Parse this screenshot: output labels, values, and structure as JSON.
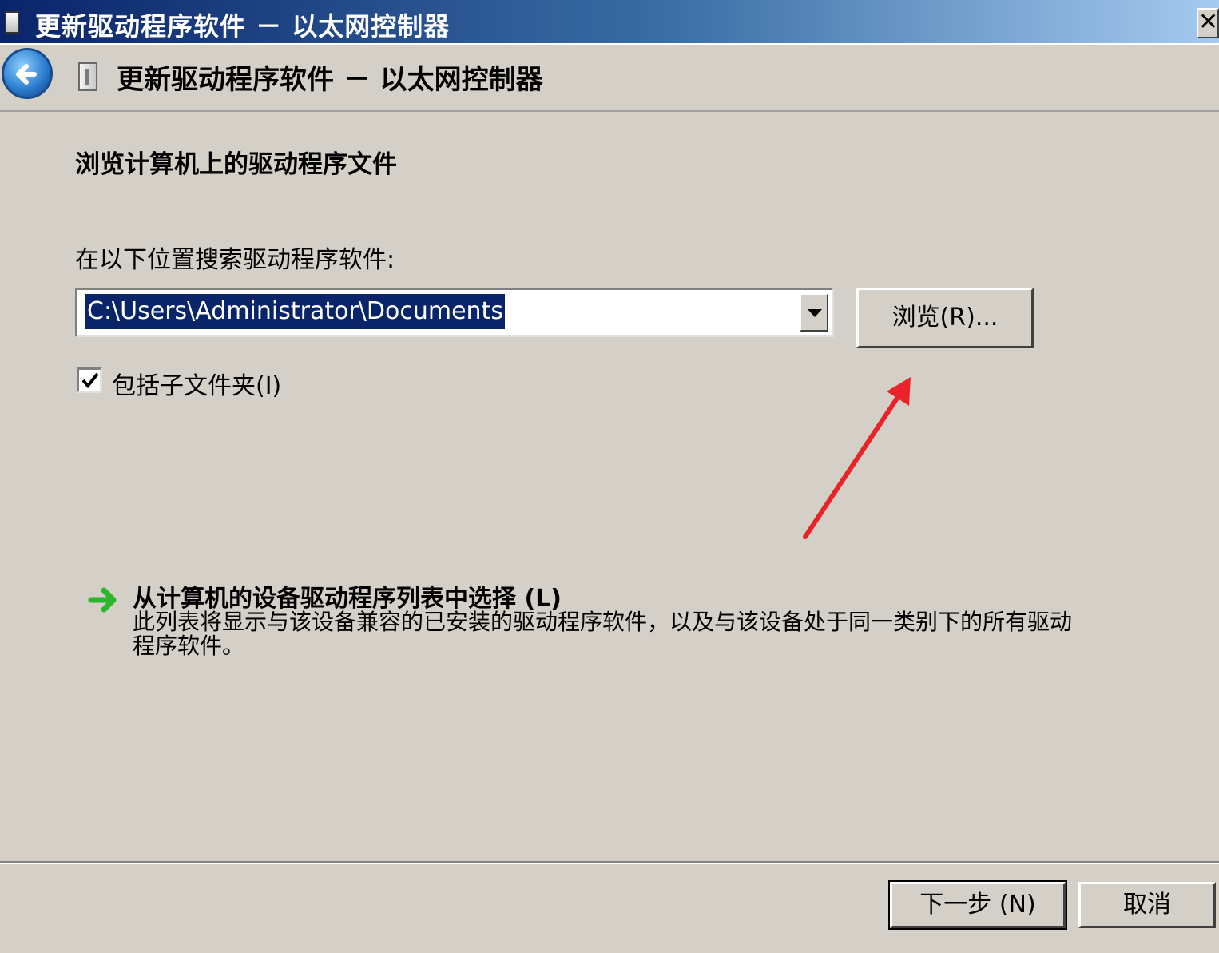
{
  "window": {
    "title": "更新驱动程序软件 － 以太网控制器",
    "close_label": "✕"
  },
  "header": {
    "title": "更新驱动程序软件 － 以太网控制器"
  },
  "main": {
    "section_title": "浏览计算机上的驱动程序文件",
    "search_label": "在以下位置搜索驱动程序软件:",
    "path_value": "C:\\Users\\Administrator\\Documents",
    "browse_label": "浏览(R)...",
    "include_subfolders_label": "包括子文件夹(I)",
    "include_subfolders_checked": true,
    "choose_title": "从计算机的设备驱动程序列表中选择 (L)",
    "choose_desc": "此列表将显示与该设备兼容的已安装的驱动程序软件，以及与该设备处于同一类别下的所有驱动程序软件。"
  },
  "footer": {
    "next_label": "下一步 (N)",
    "cancel_label": "取消"
  },
  "colors": {
    "annotation_arrow": "#e8232a",
    "link_arrow": "#2bb52b"
  }
}
